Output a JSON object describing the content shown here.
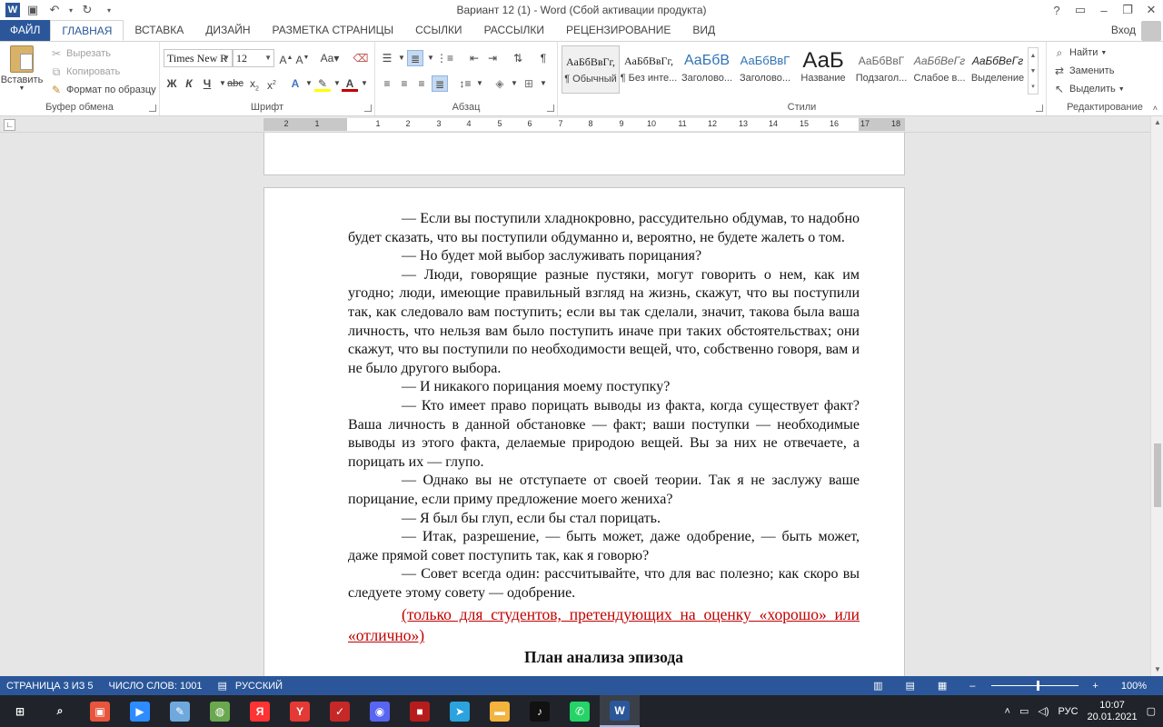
{
  "window": {
    "title": "Вариант 12 (1) - Word (Сбой активации продукта)",
    "app_logo": "W",
    "signin": "Вход"
  },
  "tabs": [
    {
      "label": "ФАЙЛ"
    },
    {
      "label": "ГЛАВНАЯ"
    },
    {
      "label": "ВСТАВКА"
    },
    {
      "label": "ДИЗАЙН"
    },
    {
      "label": "РАЗМЕТКА СТРАНИЦЫ"
    },
    {
      "label": "ССЫЛКИ"
    },
    {
      "label": "РАССЫЛКИ"
    },
    {
      "label": "РЕЦЕНЗИРОВАНИЕ"
    },
    {
      "label": "ВИД"
    }
  ],
  "clipboard": {
    "paste": "Вставить",
    "cut": "Вырезать",
    "copy": "Копировать",
    "format_painter": "Формат по образцу",
    "label": "Буфер обмена"
  },
  "font": {
    "family": "Times New R",
    "size": "12",
    "label": "Шрифт",
    "bold": "Ж",
    "italic": "К",
    "underline": "Ч"
  },
  "paragraph": {
    "label": "Абзац"
  },
  "styles": {
    "label": "Стили",
    "items": [
      {
        "preview": "АаБбВвГг,",
        "name": "¶ Обычный"
      },
      {
        "preview": "АаБбВвГг,",
        "name": "¶ Без инте..."
      },
      {
        "preview": "АаБбВ",
        "name": "Заголово..."
      },
      {
        "preview": "АаБбВвГ",
        "name": "Заголово..."
      },
      {
        "preview": "АаБ",
        "name": "Название"
      },
      {
        "preview": "АаБбВвГ",
        "name": "Подзагол..."
      },
      {
        "preview": "АаБбВеГг",
        "name": "Слабое в..."
      },
      {
        "preview": "АаБбВеГг",
        "name": "Выделение"
      }
    ]
  },
  "editing": {
    "find": "Найти",
    "replace": "Заменить",
    "select": "Выделить",
    "label": "Редактирование"
  },
  "ruler": {
    "numbers": [
      "2",
      "1",
      "1",
      "2",
      "3",
      "4",
      "5",
      "6",
      "7",
      "8",
      "9",
      "10",
      "11",
      "12",
      "13",
      "14",
      "15",
      "16",
      "17",
      "18"
    ]
  },
  "document": {
    "paragraphs": [
      "— Если вы поступили хладнокровно, рассудительно обдумав, то надобно будет сказать, что вы поступили обдуманно и, вероятно, не будете жалеть о том.",
      "— Но будет мой выбор заслуживать порицания?",
      "— Люди, говорящие разные пустяки, могут говорить о нем, как им угодно; люди, имеющие правильный взгляд на жизнь, скажут, что вы поступили так, как следовало вам поступить; если вы так сделали, значит, такова была ваша личность, что нельзя вам было поступить иначе при таких обстоятельствах; они скажут, что вы поступили по необходимости вещей, что, собственно говоря, вам и не было другого выбора.",
      "— И никакого порицания моему поступку?",
      "— Кто имеет право порицать выводы из факта, когда существует факт? Ваша личность в данной обстановке — факт; ваши поступки — необходимые выводы из этого факта, делаемые природою вещей. Вы за них не отвечаете, а порицать их — глупо.",
      "— Однако вы не отступаете от своей теории. Так я не заслужу ваше порицание, если приму предложение моего жениха?",
      "— Я был бы глуп, если бы стал порицать.",
      "— Итак, разрешение, — быть может, даже одобрение, — быть может, даже прямой совет поступить так, как я говорю?",
      "— Совет всегда один: рассчитывайте, что для вас полезно; как скоро вы следуете этому совету — одобрение."
    ],
    "red_note": "(только для студентов, претендующих на оценку «хорошо» или «отлично»)",
    "heading": "План анализа эпизода"
  },
  "status": {
    "page": "СТРАНИЦА 3 ИЗ 5",
    "words": "ЧИСЛО СЛОВ: 1001",
    "language": "РУССКИЙ",
    "zoom": "100%"
  },
  "taskbar": {
    "lang": "РУС",
    "time": "10:07",
    "date": "20.01.2021",
    "apps": [
      {
        "name": "start-icon",
        "color": "#20232a",
        "glyph": "⊞"
      },
      {
        "name": "search-icon",
        "color": "#20232a",
        "glyph": "⌕"
      },
      {
        "name": "app-red-icon",
        "color": "#e8553c",
        "glyph": "▣"
      },
      {
        "name": "zoom-icon",
        "color": "#2d8cff",
        "glyph": "▶"
      },
      {
        "name": "paint-icon",
        "color": "#6fa8dc",
        "glyph": "✎"
      },
      {
        "name": "melon-icon",
        "color": "#6aa84f",
        "glyph": "◍"
      },
      {
        "name": "yandex-icon",
        "color": "#ff3333",
        "glyph": "Я"
      },
      {
        "name": "yandex-browser-icon",
        "color": "#e53935",
        "glyph": "Y"
      },
      {
        "name": "app-check-icon",
        "color": "#c62828",
        "glyph": "✓"
      },
      {
        "name": "discord-icon",
        "color": "#5865f2",
        "glyph": "◉"
      },
      {
        "name": "app-black-icon",
        "color": "#b71c1c",
        "glyph": "■"
      },
      {
        "name": "telegram-icon",
        "color": "#2aa3de",
        "glyph": "➤"
      },
      {
        "name": "explorer-icon",
        "color": "#f3b33d",
        "glyph": "▬"
      },
      {
        "name": "tiktok-icon",
        "color": "#111111",
        "glyph": "♪"
      },
      {
        "name": "whatsapp-icon",
        "color": "#25d366",
        "glyph": "✆"
      },
      {
        "name": "word-icon",
        "color": "#2b579a",
        "glyph": "W"
      }
    ]
  }
}
